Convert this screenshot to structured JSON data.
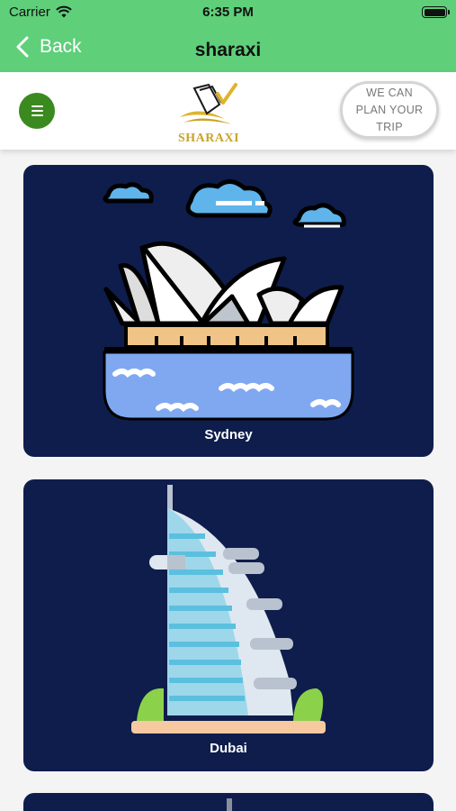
{
  "status": {
    "carrier": "Carrier",
    "time": "6:35 PM"
  },
  "nav": {
    "back_label": "Back",
    "title": "sharaxi"
  },
  "header": {
    "logo_text": "SHARAXI",
    "plan_button": [
      "WE CAN",
      "PLAN YOUR",
      "TRIP"
    ]
  },
  "cities": [
    {
      "name": "Sydney"
    },
    {
      "name": "Dubai"
    }
  ],
  "colors": {
    "nav_green": "#5fcf7a",
    "menu_green": "#3a8a1f",
    "card_navy": "#0e1d4c"
  }
}
